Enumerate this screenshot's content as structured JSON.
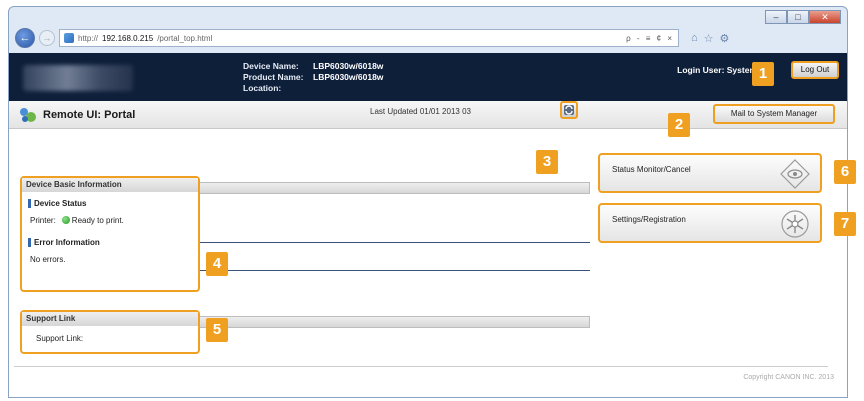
{
  "browser": {
    "url_prefix": "http://",
    "url_host": "192.168.0.215",
    "url_path": "/portal_top.html",
    "addr_tools": "ρ - ≡ ¢ ×",
    "back_glyph": "←",
    "fwd_glyph": "→",
    "min_glyph": "–",
    "max_glyph": "□",
    "close_glyph": "✕",
    "home_glyph": "⌂",
    "star_glyph": "☆",
    "gear_glyph": "⚙"
  },
  "header": {
    "device_name_label": "Device Name:",
    "device_name": "LBP6030w/6018w",
    "product_name_label": "Product Name:",
    "product_name": "LBP6030w/6018w",
    "location_label": "Location:",
    "location": "",
    "login_user": "Login User: System",
    "logout_label": "Log Out"
  },
  "titlebar": {
    "title": "Remote UI: Portal",
    "mail_label": "Mail to System Manager"
  },
  "status": {
    "last_updated": "Last Updated 01/01 2013 03"
  },
  "device_basic": {
    "heading": "Device Basic Information",
    "device_status_heading": "Device Status",
    "printer_label": "Printer:",
    "printer_status": "Ready to print.",
    "error_heading": "Error Information",
    "error_text": "No errors."
  },
  "support": {
    "heading": "Support Link",
    "link_label": "Support Link:"
  },
  "right_buttons": {
    "status_monitor": "Status Monitor/Cancel",
    "settings": "Settings/Registration"
  },
  "badges": [
    "1",
    "2",
    "3",
    "4",
    "5",
    "6",
    "7"
  ],
  "footer": {
    "copyright": "Copyright CANON INC. 2013"
  },
  "colors": {
    "highlight": "#f0a020",
    "header_bg": "#0e1f3a",
    "status_ok": "#1e9a1e"
  }
}
